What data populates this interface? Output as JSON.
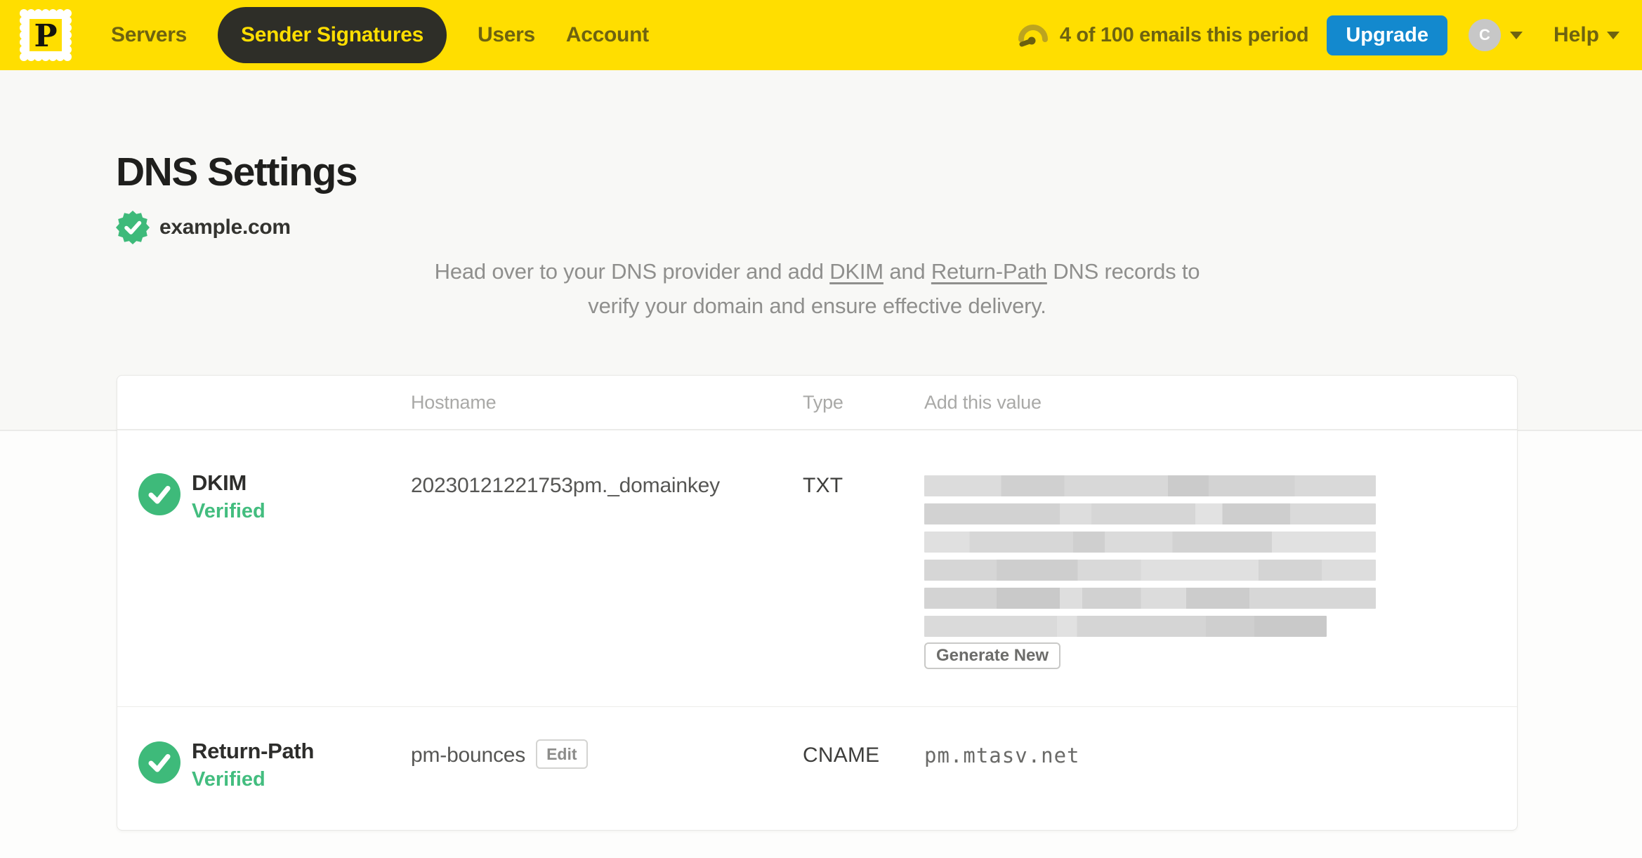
{
  "nav": {
    "logo_letter": "P",
    "servers": "Servers",
    "sender_signatures": "Sender Signatures",
    "users": "Users",
    "account": "Account",
    "usage": "4 of 100 emails this period",
    "upgrade_label": "Upgrade",
    "avatar_initial": "C",
    "help_label": "Help"
  },
  "page": {
    "title": "DNS Settings",
    "domain": "example.com",
    "intro": {
      "line1_prefix": "Head over to your DNS provider and add ",
      "dkim_link": "DKIM",
      "line1_middle": " and ",
      "return_path_link": "Return-Path",
      "line1_suffix": " DNS records to",
      "line2": "verify your domain and ensure effective delivery."
    }
  },
  "table": {
    "columns": {
      "hostname": "Hostname",
      "type": "Type",
      "value": "Add this value"
    },
    "dkim": {
      "name": "DKIM",
      "status": "Verified",
      "hostname": "20230121221753pm._domainkey",
      "type": "TXT",
      "value_redacted": true,
      "action_label": "Generate New"
    },
    "return_path": {
      "name": "Return-Path",
      "status": "Verified",
      "hostname": "pm-bounces",
      "edit_label": "Edit",
      "type": "CNAME",
      "value": "pm.mtasv.net"
    }
  },
  "colors": {
    "brand_yellow": "#FFDE00",
    "nav_active_pill": "#2E2E28",
    "nav_link": "#6E6310",
    "upgrade_blue": "#1389CE",
    "verified_green": "#3EBA7A",
    "page_background": "#F8F8F6",
    "card_background": "#FFFFFF"
  }
}
